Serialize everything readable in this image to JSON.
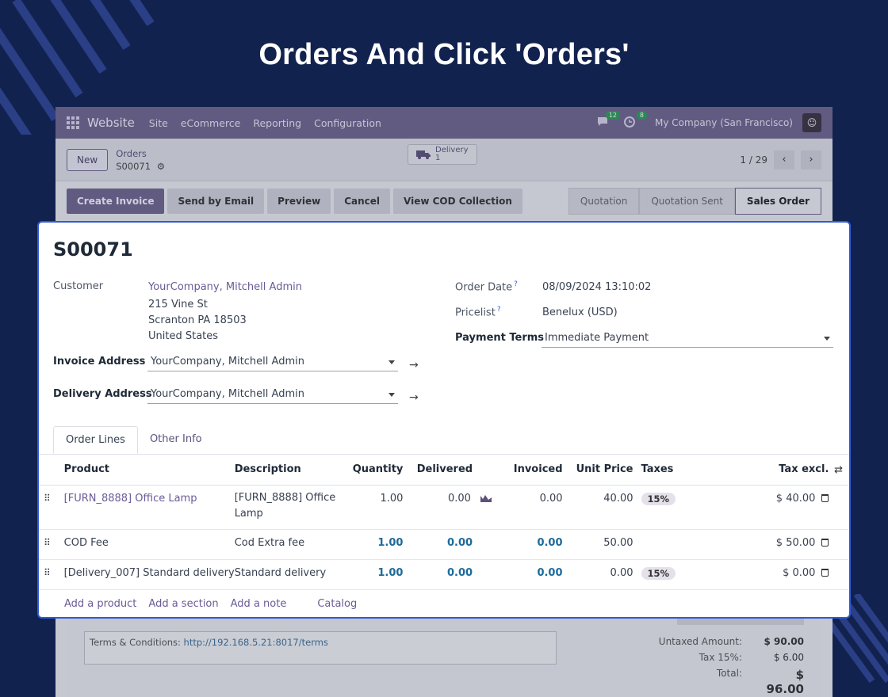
{
  "headline": "Orders And Click 'Orders'",
  "navbar": {
    "brand": "Website",
    "menu": [
      "Site",
      "eCommerce",
      "Reporting",
      "Configuration"
    ],
    "messages_count": "12",
    "activity_count": "8",
    "company": "My Company (San Francisco)"
  },
  "control_panel": {
    "new_label": "New",
    "breadcrumb_parent": "Orders",
    "breadcrumb_current": "S00071",
    "delivery_label": "Delivery",
    "delivery_count": "1",
    "pager": "1 / 29"
  },
  "actions": {
    "create_invoice": "Create Invoice",
    "send_email": "Send by Email",
    "preview": "Preview",
    "cancel": "Cancel",
    "view_cod": "View COD Collection"
  },
  "status_steps": [
    "Quotation",
    "Quotation Sent",
    "Sales Order"
  ],
  "order": {
    "name": "S00071",
    "customer_label": "Customer",
    "customer_name": "YourCompany, Mitchell Admin",
    "address_line1": "215 Vine St",
    "address_line2": "Scranton PA 18503",
    "address_line3": "United States",
    "invoice_address_label": "Invoice Address",
    "invoice_address": "YourCompany, Mitchell Admin",
    "delivery_address_label": "Delivery Address",
    "delivery_address": "YourCompany, Mitchell Admin",
    "order_date_label": "Order Date",
    "order_date": "08/09/2024 13:10:02",
    "pricelist_label": "Pricelist",
    "pricelist": "Benelux (USD)",
    "payment_terms_label": "Payment Terms",
    "payment_terms": "Immediate Payment",
    "help_mark": "?"
  },
  "tabs": [
    "Order Lines",
    "Other Info"
  ],
  "table": {
    "headers": {
      "product": "Product",
      "description": "Description",
      "quantity": "Quantity",
      "delivered": "Delivered",
      "invoiced": "Invoiced",
      "unit_price": "Unit Price",
      "taxes": "Taxes",
      "tax_excl": "Tax excl."
    },
    "rows": [
      {
        "product": "[FURN_8888] Office Lamp",
        "description": "[FURN_8888] Office Lamp",
        "quantity": "1.00",
        "delivered": "0.00",
        "invoiced": "0.00",
        "unit_price": "40.00",
        "taxes": "15%",
        "subtotal": "$ 40.00"
      },
      {
        "product": "COD Fee",
        "description": "Cod Extra fee",
        "quantity": "1.00",
        "delivered": "0.00",
        "invoiced": "0.00",
        "unit_price": "50.00",
        "taxes": "",
        "subtotal": "$ 50.00"
      },
      {
        "product": "[Delivery_007] Standard delivery",
        "description": "Standard delivery",
        "quantity": "1.00",
        "delivered": "0.00",
        "invoiced": "0.00",
        "unit_price": "0.00",
        "taxes": "15%",
        "subtotal": "$ 0.00"
      }
    ]
  },
  "add_links": {
    "product": "Add a product",
    "section": "Add a section",
    "note": "Add a note",
    "catalog": "Catalog"
  },
  "terms": {
    "label": "Terms & Conditions:",
    "url": "http://192.168.5.21:8017/terms"
  },
  "totals": {
    "untaxed_label": "Untaxed Amount:",
    "untaxed": "$ 90.00",
    "tax_label": "Tax 15%:",
    "tax": "$ 6.00",
    "total_label": "Total:",
    "total": "$ 96.00"
  },
  "colors": {
    "background": "#12224f",
    "accent": "#6e648e",
    "highlight_border": "#2f5bd8"
  }
}
